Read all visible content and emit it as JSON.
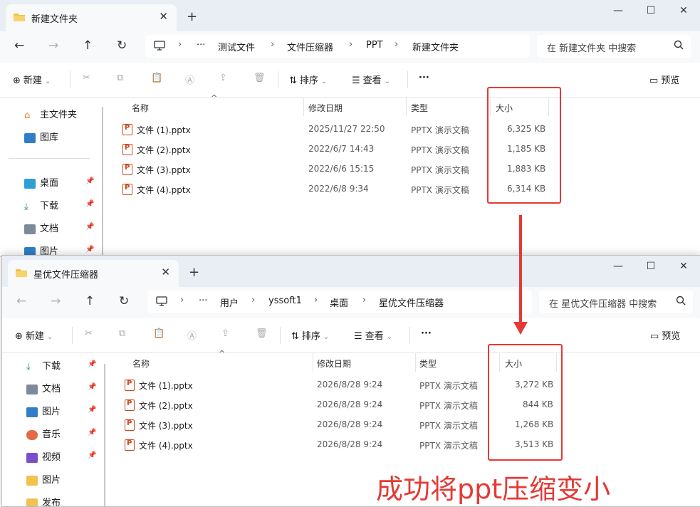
{
  "window1": {
    "tab_title": "新建文件夹",
    "new_tab": "+",
    "close_tab": "✕",
    "controls": {
      "minimize": "—",
      "maximize": "☐",
      "close": "✕"
    },
    "breadcrumbs": [
      "测试文件",
      "文件压缩器",
      "PPT",
      "新建文件夹"
    ],
    "ellipsis": "···",
    "search_placeholder": "在 新建文件夹 中搜索",
    "commands": {
      "new": "新建",
      "sort": "排序",
      "view": "查看",
      "more": "···",
      "preview": "预览"
    },
    "sidebar": [
      {
        "label": "主文件夹",
        "pinned": false
      },
      {
        "label": "图库",
        "pinned": false
      },
      {
        "label": "桌面",
        "pinned": true
      },
      {
        "label": "下载",
        "pinned": true
      },
      {
        "label": "文档",
        "pinned": true
      },
      {
        "label": "图片",
        "pinned": true
      }
    ],
    "columns": {
      "name": "名称",
      "modified": "修改日期",
      "type": "类型",
      "size": "大小"
    },
    "files": [
      {
        "name": "文件 (1).pptx",
        "modified": "2025/11/27 22:50",
        "type": "PPTX 演示文稿",
        "size": "6,325 KB"
      },
      {
        "name": "文件 (2).pptx",
        "modified": "2022/6/7 14:43",
        "type": "PPTX 演示文稿",
        "size": "1,185 KB"
      },
      {
        "name": "文件 (3).pptx",
        "modified": "2022/6/6 15:15",
        "type": "PPTX 演示文稿",
        "size": "1,883 KB"
      },
      {
        "name": "文件 (4).pptx",
        "modified": "2022/6/8 9:34",
        "type": "PPTX 演示文稿",
        "size": "6,314 KB"
      }
    ]
  },
  "window2": {
    "tab_title": "星优文件压缩器",
    "new_tab": "+",
    "close_tab": "✕",
    "controls": {
      "minimize": "—",
      "maximize": "☐",
      "close": "✕"
    },
    "breadcrumbs": [
      "用户",
      "yssoft1",
      "桌面",
      "星优文件压缩器"
    ],
    "ellipsis": "···",
    "search_placeholder": "在 星优文件压缩器 中搜索",
    "commands": {
      "new": "新建",
      "sort": "排序",
      "view": "查看",
      "more": "···",
      "preview": "预览"
    },
    "sidebar": [
      {
        "label": "下载",
        "pinned": true
      },
      {
        "label": "文档",
        "pinned": true
      },
      {
        "label": "图片",
        "pinned": true
      },
      {
        "label": "音乐",
        "pinned": true
      },
      {
        "label": "视频",
        "pinned": true
      },
      {
        "label": "图片",
        "pinned": false
      },
      {
        "label": "发布",
        "pinned": false
      }
    ],
    "columns": {
      "name": "名称",
      "modified": "修改日期",
      "type": "类型",
      "size": "大小"
    },
    "files": [
      {
        "name": "文件 (1).pptx",
        "modified": "2026/8/28 9:24",
        "type": "PPTX 演示文稿",
        "size": "3,272 KB"
      },
      {
        "name": "文件 (2).pptx",
        "modified": "2026/8/28 9:24",
        "type": "PPTX 演示文稿",
        "size": "844 KB"
      },
      {
        "name": "文件 (3).pptx",
        "modified": "2026/8/28 9:24",
        "type": "PPTX 演示文稿",
        "size": "1,268 KB"
      },
      {
        "name": "文件 (4).pptx",
        "modified": "2026/8/28 9:24",
        "type": "PPTX 演示文稿",
        "size": "3,513 KB"
      }
    ]
  },
  "annotation": {
    "caption": "成功将ppt压缩变小",
    "color": "#e53935"
  },
  "colors": {
    "folder": "#f2c14e",
    "highlight_red": "#e53935",
    "ppt_icon": "#c8481d"
  }
}
